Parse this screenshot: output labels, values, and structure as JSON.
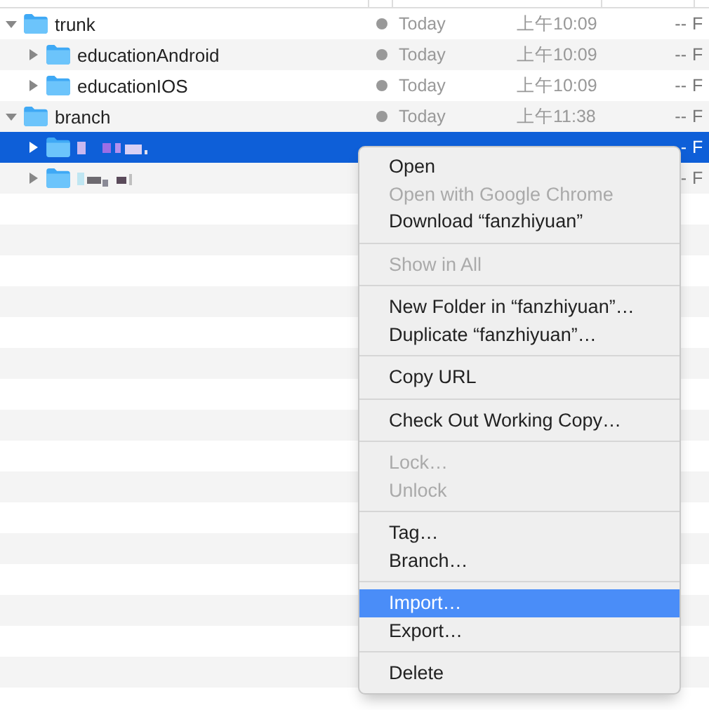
{
  "rows": [
    {
      "name": "trunk",
      "kind": "folder",
      "expanded": true,
      "selected": false,
      "date": "Today",
      "time": "上午10:09",
      "size": "--",
      "kind_col": "F",
      "children": [
        {
          "name": "educationAndroid",
          "kind": "folder",
          "expanded": false,
          "selected": false,
          "date": "Today",
          "time": "上午10:09",
          "size": "--",
          "kind_col": "F"
        },
        {
          "name": "educationIOS",
          "kind": "folder",
          "expanded": false,
          "selected": false,
          "date": "Today",
          "time": "上午10:09",
          "size": "--",
          "kind_col": "F"
        }
      ]
    },
    {
      "name": "branch",
      "kind": "folder",
      "expanded": true,
      "selected": false,
      "date": "Today",
      "time": "上午11:38",
      "size": "--",
      "kind_col": "F",
      "children": [
        {
          "kind": "redacted",
          "expanded": false,
          "selected": true,
          "size": "-",
          "kind_col": "F"
        },
        {
          "kind": "redacted",
          "expanded": false,
          "selected": false,
          "size": "-",
          "kind_col": "F"
        }
      ]
    }
  ],
  "context_menu": [
    {
      "kind": "item",
      "label": "Open",
      "disabled": false,
      "selected": false
    },
    {
      "kind": "item",
      "label": "Open with Google Chrome",
      "disabled": true,
      "selected": false
    },
    {
      "kind": "item",
      "label": "Download “fanzhiyuan”",
      "disabled": false,
      "selected": false
    },
    {
      "kind": "separator"
    },
    {
      "kind": "item",
      "label": "Show in All",
      "disabled": true,
      "selected": false
    },
    {
      "kind": "separator"
    },
    {
      "kind": "item",
      "label": "New Folder in “fanzhiyuan”…",
      "disabled": false,
      "selected": false
    },
    {
      "kind": "item",
      "label": "Duplicate “fanzhiyuan”…",
      "disabled": false,
      "selected": false
    },
    {
      "kind": "separator"
    },
    {
      "kind": "item",
      "label": "Copy URL",
      "disabled": false,
      "selected": false
    },
    {
      "kind": "separator"
    },
    {
      "kind": "item",
      "label": "Check Out Working Copy…",
      "disabled": false,
      "selected": false
    },
    {
      "kind": "separator"
    },
    {
      "kind": "item",
      "label": "Lock…",
      "disabled": true,
      "selected": false
    },
    {
      "kind": "item",
      "label": "Unlock",
      "disabled": true,
      "selected": false
    },
    {
      "kind": "separator"
    },
    {
      "kind": "item",
      "label": "Tag…",
      "disabled": false,
      "selected": false
    },
    {
      "kind": "item",
      "label": "Branch…",
      "disabled": false,
      "selected": false
    },
    {
      "kind": "separator"
    },
    {
      "kind": "item",
      "label": "Import…",
      "disabled": false,
      "selected": true
    },
    {
      "kind": "item",
      "label": "Export…",
      "disabled": false,
      "selected": false
    },
    {
      "kind": "separator"
    },
    {
      "kind": "item",
      "label": "Delete",
      "disabled": false,
      "selected": false
    }
  ]
}
